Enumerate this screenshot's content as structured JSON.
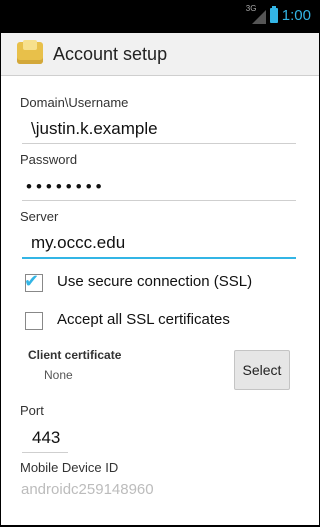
{
  "status_bar": {
    "network": "3G",
    "time": "1:00"
  },
  "actionbar": {
    "title": "Account setup",
    "icon": "account-setup-icon"
  },
  "form": {
    "domain_username": {
      "label": "Domain\\Username",
      "value": "\\justin.k.example"
    },
    "password": {
      "label": "Password",
      "value": "••••••••"
    },
    "server": {
      "label": "Server",
      "value": "my.occc.edu"
    },
    "ssl": {
      "label": "Use secure connection (SSL)",
      "checked": true
    },
    "accept_all": {
      "label": "Accept all SSL certificates",
      "checked": false
    },
    "client_certificate": {
      "label": "Client certificate",
      "value": "None",
      "button": "Select"
    },
    "port": {
      "label": "Port",
      "value": "443"
    },
    "mobile_device_id": {
      "label": "Mobile Device ID",
      "value": "androidc259148960"
    }
  },
  "colors": {
    "accent": "#33b5e5"
  }
}
